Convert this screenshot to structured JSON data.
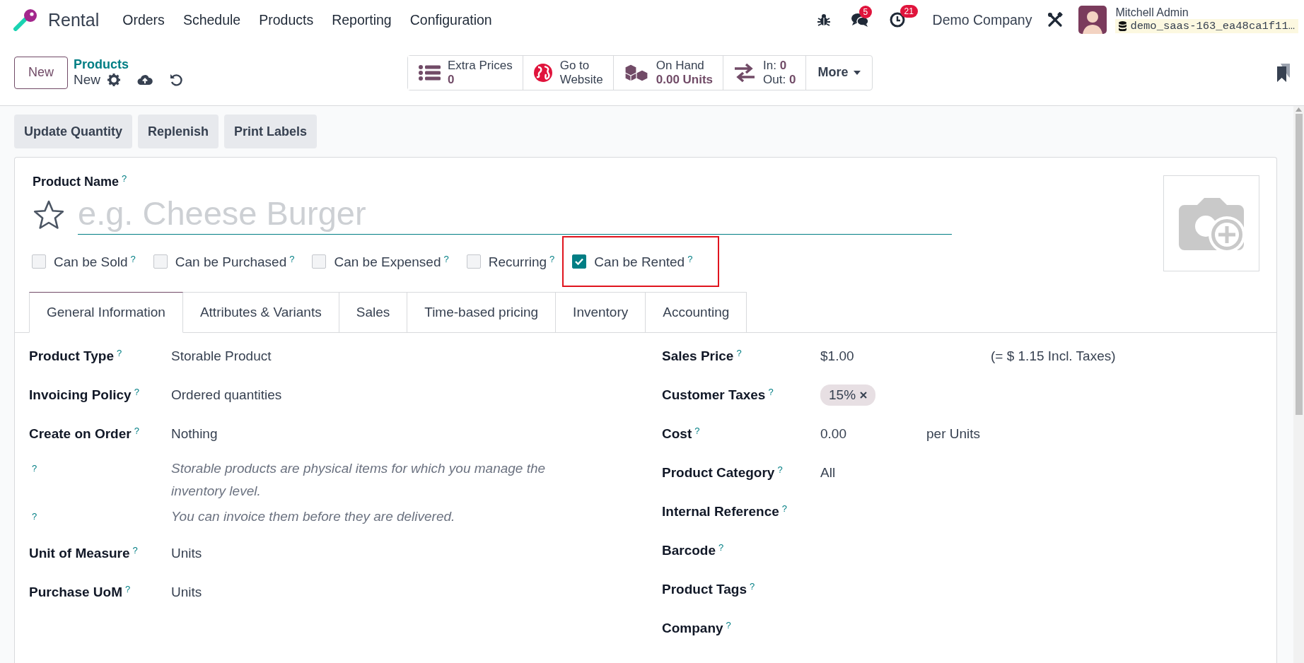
{
  "navbar": {
    "app_name": "Rental",
    "menu": [
      "Orders",
      "Schedule",
      "Products",
      "Reporting",
      "Configuration"
    ],
    "messages_badge": "5",
    "activities_badge": "21",
    "company": "Demo Company",
    "user_name": "Mitchell Admin",
    "database": "demo_saas-163_ea48ca1f11…"
  },
  "control_panel": {
    "new_button": "New",
    "breadcrumb": "Products",
    "record_title": "New",
    "smart_buttons": [
      {
        "kind": "stat",
        "label": "Extra Prices",
        "value": "0"
      },
      {
        "kind": "text",
        "lines": [
          "Go to",
          "Website"
        ]
      },
      {
        "kind": "stat",
        "label": "On Hand",
        "value": "0.00 Units"
      },
      {
        "kind": "text",
        "lines": [
          "In: **0**",
          "Out: **0**"
        ]
      }
    ],
    "more_button": "More"
  },
  "actions": [
    "Update Quantity",
    "Replenish",
    "Print Labels"
  ],
  "form": {
    "name_label": "Product Name",
    "name_help": "?",
    "name_placeholder": "e.g. Cheese Burger",
    "favorite": false,
    "checkboxes": [
      {
        "label": "Can be Sold",
        "help": "?",
        "checked": false,
        "highlighted": false
      },
      {
        "label": "Can be Purchased",
        "help": "?",
        "checked": false,
        "highlighted": false
      },
      {
        "label": "Can be Expensed",
        "help": "?",
        "checked": false,
        "highlighted": false
      },
      {
        "label": "Recurring",
        "help": "?",
        "checked": false,
        "highlighted": false
      },
      {
        "label": "Can be Rented",
        "help": "?",
        "checked": true,
        "highlighted": true
      }
    ],
    "tabs": [
      {
        "label": "General Information",
        "selected": true
      },
      {
        "label": "Attributes & Variants",
        "selected": false
      },
      {
        "label": "Sales",
        "selected": false
      },
      {
        "label": "Time-based pricing",
        "selected": false
      },
      {
        "label": "Inventory",
        "selected": false
      },
      {
        "label": "Accounting",
        "selected": false
      }
    ],
    "left_fields": [
      {
        "kind": "field",
        "label": "Product Type",
        "help": "?",
        "value": "Storable Product"
      },
      {
        "kind": "field",
        "label": "Invoicing Policy",
        "help": "?",
        "value": "Ordered quantities"
      },
      {
        "kind": "field",
        "label": "Create on Order",
        "help": "?",
        "value": "Nothing"
      },
      {
        "kind": "note",
        "help": "?",
        "text": "Storable products are physical items for which you manage the inventory level."
      },
      {
        "kind": "note",
        "help": "?",
        "text": "You can invoice them before they are delivered."
      },
      {
        "kind": "field",
        "label": "Unit of Measure",
        "help": "?",
        "value": "Units"
      },
      {
        "kind": "field",
        "label": "Purchase UoM",
        "help": "?",
        "value": "Units"
      }
    ],
    "right_fields": [
      {
        "kind": "price",
        "label": "Sales Price",
        "help": "?",
        "value": "$1.00",
        "extra": "(= $ 1.15 Incl. Taxes)"
      },
      {
        "kind": "tags",
        "label": "Customer Taxes",
        "help": "?",
        "tags": [
          "15%"
        ]
      },
      {
        "kind": "measured",
        "label": "Cost",
        "help": "?",
        "value": "0.00",
        "extra": "per Units"
      },
      {
        "kind": "field",
        "label": "Product Category",
        "help": "?",
        "value": "All"
      },
      {
        "kind": "field",
        "label": "Internal Reference",
        "help": "?"
      },
      {
        "kind": "field",
        "label": "Barcode",
        "help": "?"
      },
      {
        "kind": "field",
        "label": "Product Tags",
        "help": "?"
      },
      {
        "kind": "field",
        "label": "Company",
        "help": "?"
      }
    ]
  }
}
